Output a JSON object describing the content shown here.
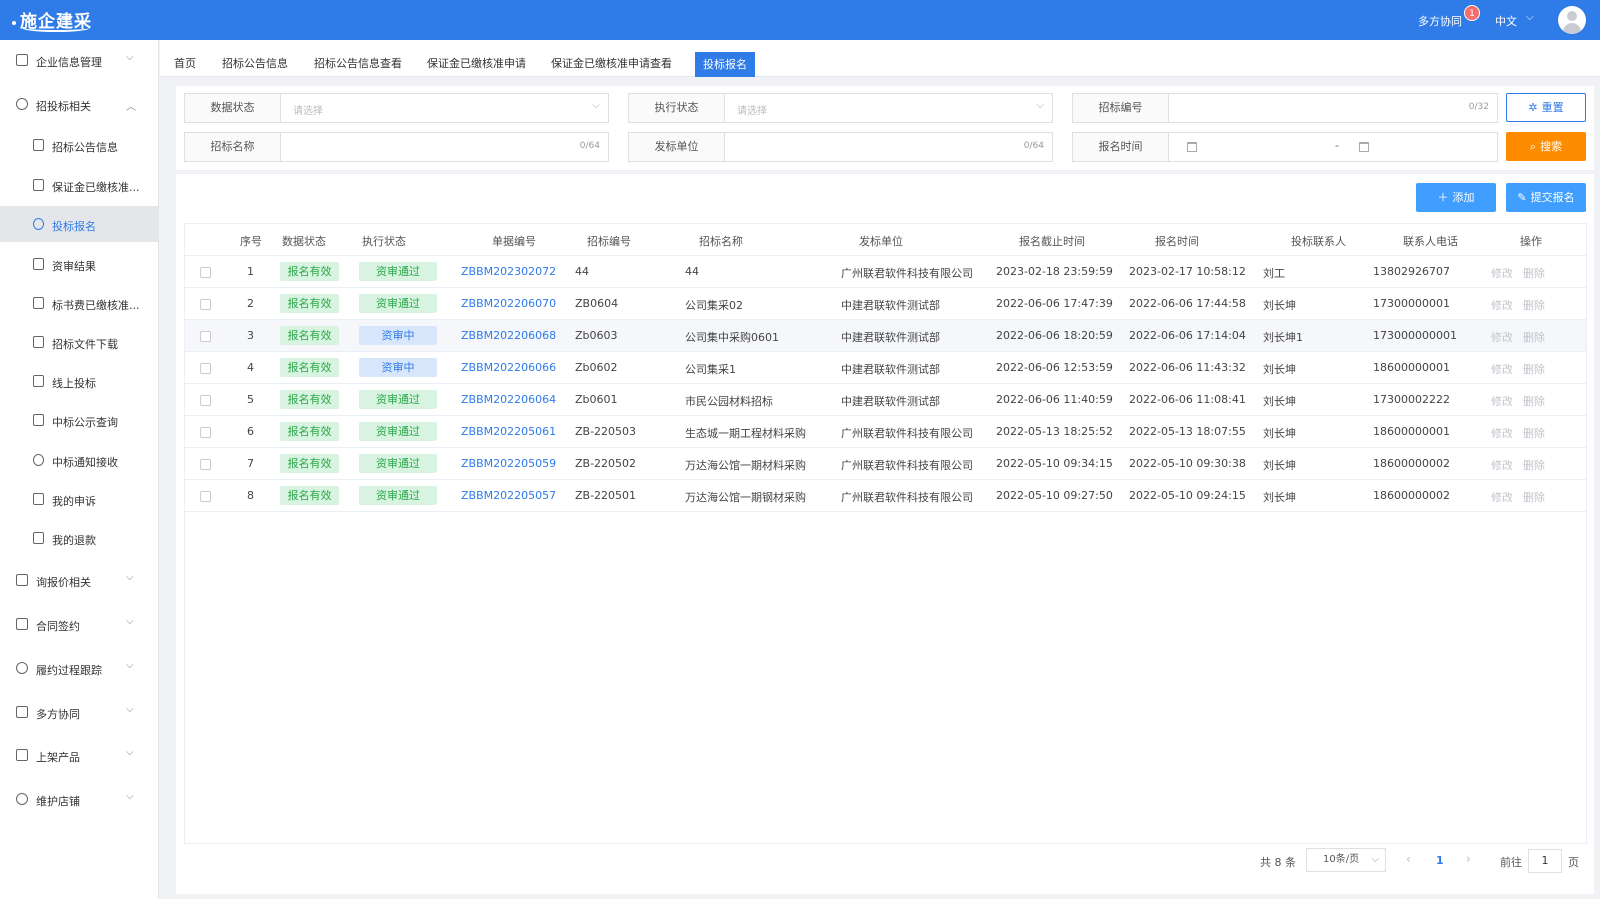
{
  "header": {
    "logo_text": "施企建采",
    "collab_label": "多方协同",
    "notify_count": "1",
    "language": "中文"
  },
  "sidebar": {
    "groups": [
      {
        "label": "企业信息管理"
      },
      {
        "label": "招投标相关"
      },
      {
        "label": "询报价相关"
      },
      {
        "label": "合同签约"
      },
      {
        "label": "履约过程跟踪"
      },
      {
        "label": "多方协同"
      },
      {
        "label": "上架产品"
      },
      {
        "label": "维护店铺"
      }
    ],
    "sub_items": [
      {
        "label": "招标公告信息"
      },
      {
        "label": "保证金已缴核准..."
      },
      {
        "label": "投标报名"
      },
      {
        "label": "资审结果"
      },
      {
        "label": "标书费已缴核准..."
      },
      {
        "label": "招标文件下载"
      },
      {
        "label": "线上投标"
      },
      {
        "label": "中标公示查询"
      },
      {
        "label": "中标通知接收"
      },
      {
        "label": "我的申诉"
      },
      {
        "label": "我的退款"
      }
    ]
  },
  "tabs": [
    {
      "label": "首页"
    },
    {
      "label": "招标公告信息"
    },
    {
      "label": "招标公告信息查看"
    },
    {
      "label": "保证金已缴核准申请"
    },
    {
      "label": "保证金已缴核准申请查看"
    },
    {
      "label": "投标报名"
    }
  ],
  "filters": {
    "data_status": {
      "label": "数据状态",
      "placeholder": "请选择"
    },
    "exec_status": {
      "label": "执行状态",
      "placeholder": "请选择"
    },
    "bid_no": {
      "label": "招标编号",
      "count": "0/32"
    },
    "bid_name": {
      "label": "招标名称",
      "count": "0/64"
    },
    "issuer": {
      "label": "发标单位",
      "count": "0/64"
    },
    "signup_time": {
      "label": "报名时间",
      "separator": "-"
    }
  },
  "buttons": {
    "reset": "重置",
    "search": "搜索",
    "add": "添加",
    "submit": "提交报名"
  },
  "table": {
    "headers": {
      "seq": "序号",
      "data_status": "数据状态",
      "exec_status": "执行状态",
      "doc_no": "单据编号",
      "bid_no": "招标编号",
      "bid_name": "招标名称",
      "issuer": "发标单位",
      "deadline": "报名截止时间",
      "signup_time": "报名时间",
      "contact": "投标联系人",
      "phone": "联系人电话",
      "ops": "操作"
    },
    "op_edit": "修改",
    "op_delete": "删除",
    "rows": [
      {
        "seq": "1",
        "data_status": "报名有效",
        "exec_status": "资审通过",
        "exec_kind": "green",
        "doc_no": "ZBBM202302072",
        "bid_no": "44",
        "bid_name": "44",
        "issuer": "广州联君软件科技有限公司",
        "deadline": "2023-02-18 23:59:59",
        "signup_time": "2023-02-17 10:58:12",
        "contact": "刘工",
        "phone": "13802926707"
      },
      {
        "seq": "2",
        "data_status": "报名有效",
        "exec_status": "资审通过",
        "exec_kind": "green",
        "doc_no": "ZBBM202206070",
        "bid_no": "ZB0604",
        "bid_name": "公司集采02",
        "issuer": "中建君联软件测试部",
        "deadline": "2022-06-06 17:47:39",
        "signup_time": "2022-06-06 17:44:58",
        "contact": "刘长坤",
        "phone": "17300000001"
      },
      {
        "seq": "3",
        "data_status": "报名有效",
        "exec_status": "资审中",
        "exec_kind": "blue",
        "doc_no": "ZBBM202206068",
        "bid_no": "Zb0603",
        "bid_name": "公司集中采购0601",
        "issuer": "中建君联软件测试部",
        "deadline": "2022-06-06 18:20:59",
        "signup_time": "2022-06-06 17:14:04",
        "contact": "刘长坤1",
        "phone": "173000000001"
      },
      {
        "seq": "4",
        "data_status": "报名有效",
        "exec_status": "资审中",
        "exec_kind": "blue",
        "doc_no": "ZBBM202206066",
        "bid_no": "Zb0602",
        "bid_name": "公司集采1",
        "issuer": "中建君联软件测试部",
        "deadline": "2022-06-06 12:53:59",
        "signup_time": "2022-06-06 11:43:32",
        "contact": "刘长坤",
        "phone": "18600000001"
      },
      {
        "seq": "5",
        "data_status": "报名有效",
        "exec_status": "资审通过",
        "exec_kind": "green",
        "doc_no": "ZBBM202206064",
        "bid_no": "Zb0601",
        "bid_name": "市民公园材料招标",
        "issuer": "中建君联软件测试部",
        "deadline": "2022-06-06 11:40:59",
        "signup_time": "2022-06-06 11:08:41",
        "contact": "刘长坤",
        "phone": "17300002222"
      },
      {
        "seq": "6",
        "data_status": "报名有效",
        "exec_status": "资审通过",
        "exec_kind": "green",
        "doc_no": "ZBBM202205061",
        "bid_no": "ZB-220503",
        "bid_name": "生态城一期工程材料采购",
        "issuer": "广州联君软件科技有限公司",
        "deadline": "2022-05-13 18:25:52",
        "signup_time": "2022-05-13 18:07:55",
        "contact": "刘长坤",
        "phone": "18600000001"
      },
      {
        "seq": "7",
        "data_status": "报名有效",
        "exec_status": "资审通过",
        "exec_kind": "green",
        "doc_no": "ZBBM202205059",
        "bid_no": "ZB-220502",
        "bid_name": "万达海公馆一期材料采购",
        "issuer": "广州联君软件科技有限公司",
        "deadline": "2022-05-10 09:34:15",
        "signup_time": "2022-05-10 09:30:38",
        "contact": "刘长坤",
        "phone": "18600000002"
      },
      {
        "seq": "8",
        "data_status": "报名有效",
        "exec_status": "资审通过",
        "exec_kind": "green",
        "doc_no": "ZBBM202205057",
        "bid_no": "ZB-220501",
        "bid_name": "万达海公馆一期钢材采购",
        "issuer": "广州联君软件科技有限公司",
        "deadline": "2022-05-10 09:27:50",
        "signup_time": "2022-05-10 09:24:15",
        "contact": "刘长坤",
        "phone": "18600000002"
      }
    ]
  },
  "pagination": {
    "total": "共 8 条",
    "page_size": "10条/页",
    "current_page": "1",
    "goto_label": "前往",
    "goto_value": "1",
    "goto_unit": "页"
  },
  "colors": {
    "primary": "#2f7be8",
    "search": "#ff8c00",
    "tag_green_bg": "#d8f3e0",
    "tag_blue_bg": "#d8e6fb"
  }
}
